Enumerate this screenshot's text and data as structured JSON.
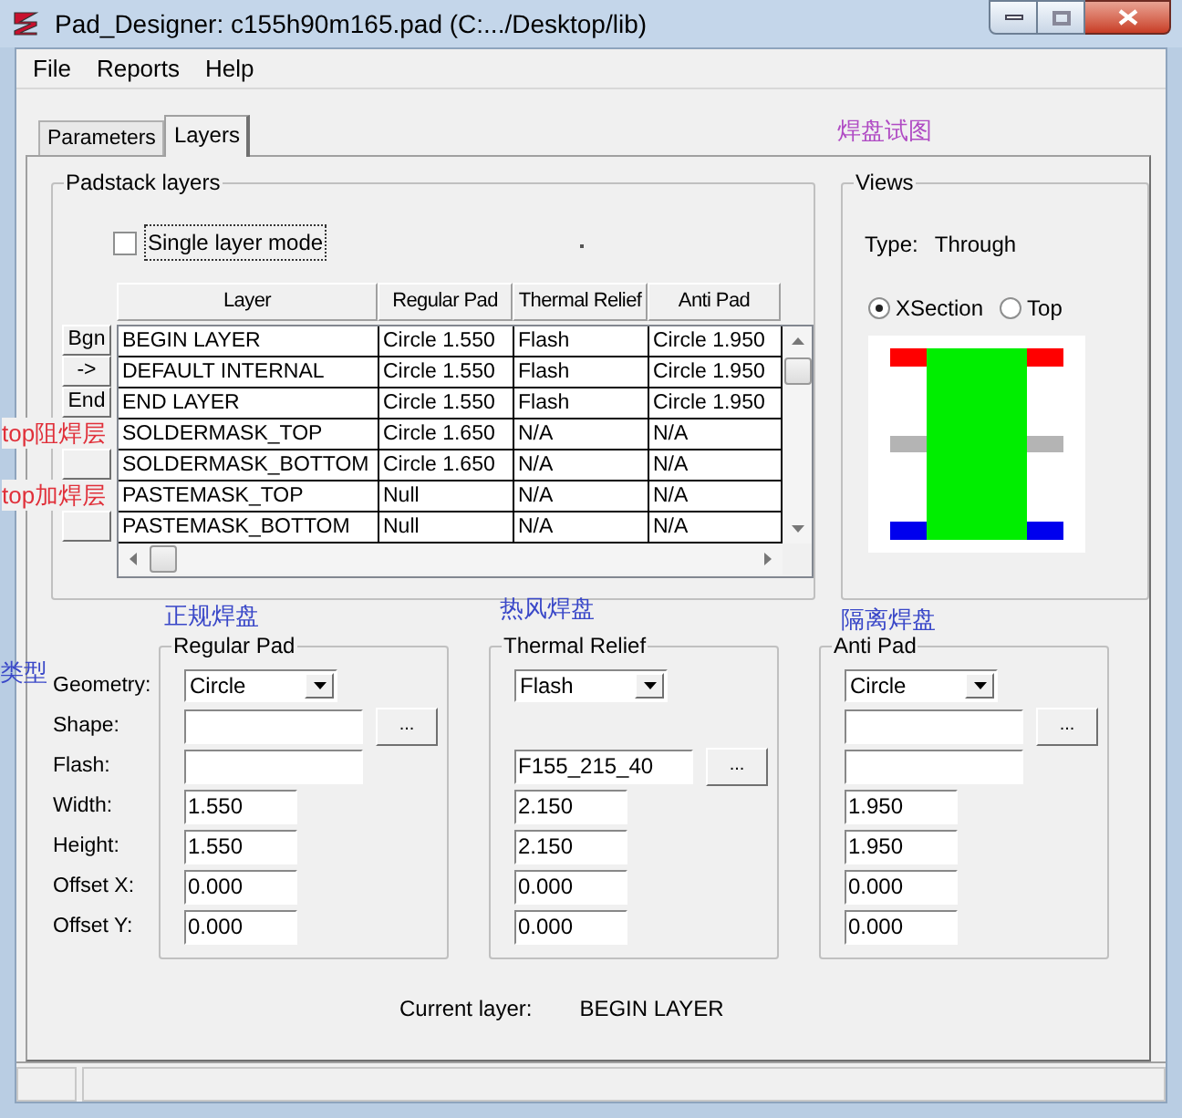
{
  "window": {
    "title": "Pad_Designer: c155h90m165.pad (C:.../Desktop/lib)"
  },
  "menu": [
    "File",
    "Reports",
    "Help"
  ],
  "tabs": [
    {
      "label": "Parameters",
      "selected": false
    },
    {
      "label": "Layers",
      "selected": true
    }
  ],
  "annotations": [
    {
      "text": "焊盘试图",
      "color": "#b04cc4"
    },
    {
      "text": "正规焊盘",
      "color": "#3a48c8"
    },
    {
      "text": "热风焊盘",
      "color": "#3a48c8"
    },
    {
      "text": "隔离焊盘",
      "color": "#3a48c8"
    },
    {
      "text": "类型",
      "color": "#3a48c8"
    }
  ],
  "padstack_layers": {
    "title": "Padstack layers",
    "single_layer_mode": {
      "label": "Single layer mode",
      "checked": false
    },
    "columns": [
      "Layer",
      "Regular Pad",
      "Thermal Relief",
      "Anti Pad"
    ],
    "rows": [
      {
        "button": "Bgn",
        "cells": [
          "BEGIN LAYER",
          "Circle 1.550",
          "Flash",
          "Circle 1.950"
        ]
      },
      {
        "button": "->",
        "cells": [
          "DEFAULT INTERNAL",
          "Circle 1.550",
          "Flash",
          "Circle 1.950"
        ]
      },
      {
        "button": "End",
        "cells": [
          "END LAYER",
          "Circle 1.550",
          "Flash",
          "Circle 1.950"
        ]
      },
      {
        "note": {
          "text": "top阻焊层",
          "color": "#e0303a"
        },
        "cells": [
          "SOLDERMASK_TOP",
          "Circle 1.650",
          "N/A",
          "N/A"
        ]
      },
      {
        "cells": [
          "SOLDERMASK_BOTTOM",
          "Circle 1.650",
          "N/A",
          "N/A"
        ]
      },
      {
        "note": {
          "text": "top加焊层",
          "color": "#e0303a"
        },
        "cells": [
          "PASTEMASK_TOP",
          "Null",
          "N/A",
          "N/A"
        ]
      },
      {
        "cells": [
          "PASTEMASK_BOTTOM",
          "Null",
          "N/A",
          "N/A"
        ]
      }
    ]
  },
  "views": {
    "title": "Views",
    "type_label": "Type:",
    "type_value": "Through",
    "radios": [
      {
        "label": "XSection",
        "selected": true
      },
      {
        "label": "Top",
        "selected": false
      }
    ]
  },
  "field_labels": [
    "Geometry:",
    "Shape:",
    "Flash:",
    "Width:",
    "Height:",
    "Offset X:",
    "Offset Y:"
  ],
  "pad_groups": [
    {
      "title": "Regular Pad",
      "fields": [
        {
          "kind": "dropdown",
          "value": "Circle"
        },
        {
          "kind": "text",
          "button": "..."
        },
        {
          "kind": "text"
        },
        {
          "kind": "number",
          "value": "1.550"
        },
        {
          "kind": "number",
          "value": "1.550"
        },
        {
          "kind": "number",
          "value": "0.000"
        },
        {
          "kind": "number",
          "value": "0.000"
        }
      ]
    },
    {
      "title": "Thermal Relief",
      "fields": [
        {
          "kind": "dropdown",
          "value": "Flash"
        },
        {
          "kind": "none"
        },
        {
          "kind": "text",
          "value": "F155_215_40",
          "button": "..."
        },
        {
          "kind": "number",
          "value": "2.150"
        },
        {
          "kind": "number",
          "value": "2.150"
        },
        {
          "kind": "number",
          "value": "0.000"
        },
        {
          "kind": "number",
          "value": "0.000"
        }
      ]
    },
    {
      "title": "Anti Pad",
      "fields": [
        {
          "kind": "dropdown",
          "value": "Circle"
        },
        {
          "kind": "text",
          "button": "..."
        },
        {
          "kind": "text"
        },
        {
          "kind": "number",
          "value": "1.950"
        },
        {
          "kind": "number",
          "value": "1.950"
        },
        {
          "kind": "number",
          "value": "0.000"
        },
        {
          "kind": "number",
          "value": "0.000"
        }
      ]
    }
  ],
  "current_layer": {
    "label": "Current layer:",
    "value": "BEGIN LAYER"
  }
}
